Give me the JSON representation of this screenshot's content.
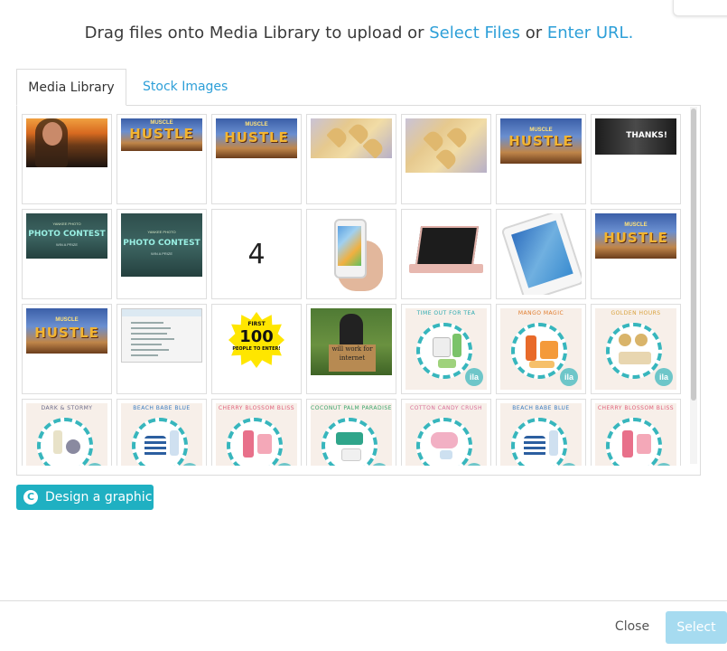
{
  "upload_prompt": {
    "prefix": "Drag files onto Media Library to upload or ",
    "select_files_link": "Select Files",
    "middle": " or ",
    "enter_url_link": "Enter URL."
  },
  "tabs": {
    "media_library": "Media Library",
    "stock_images": "Stock Images"
  },
  "thumbnail_texts": {
    "hustle_sub": "MUSCLE",
    "hustle_logo": "HUSTLE",
    "thanks": "THANKS!",
    "photo_contest_top": "YANKEE PHOTO",
    "photo_contest": "PHOTO CONTEST",
    "photo_contest_bottom": "WIN A PRIZE",
    "number_four": "4",
    "badge_first": "FIRST",
    "badge_number": "100",
    "badge_people": "PEOPLE TO ENTER!",
    "sign_text": "will work for internet",
    "ila_logo": "ila",
    "ila_titles": [
      "TIME OUT FOR TEA",
      "MANGO MAGIC",
      "GOLDEN HOURS",
      "DARK & STORMY",
      "BEACH BABE BLUE",
      "CHERRY BLOSSOM BLISS",
      "COCONUT PALM PARADISE",
      "COTTON CANDY CRUSH",
      "BEACH BABE BLUE",
      "CHERRY BLOSSOM BLISS"
    ]
  },
  "colors": {
    "link": "#2d9fd8",
    "design_button": "#1fb0c2",
    "select_button": "#a6dbf0",
    "ila_accent": "#37b6bd"
  },
  "design_button": {
    "icon": "C",
    "label": "Design a graphic"
  },
  "footer": {
    "close_label": "Close",
    "select_label": "Select"
  }
}
